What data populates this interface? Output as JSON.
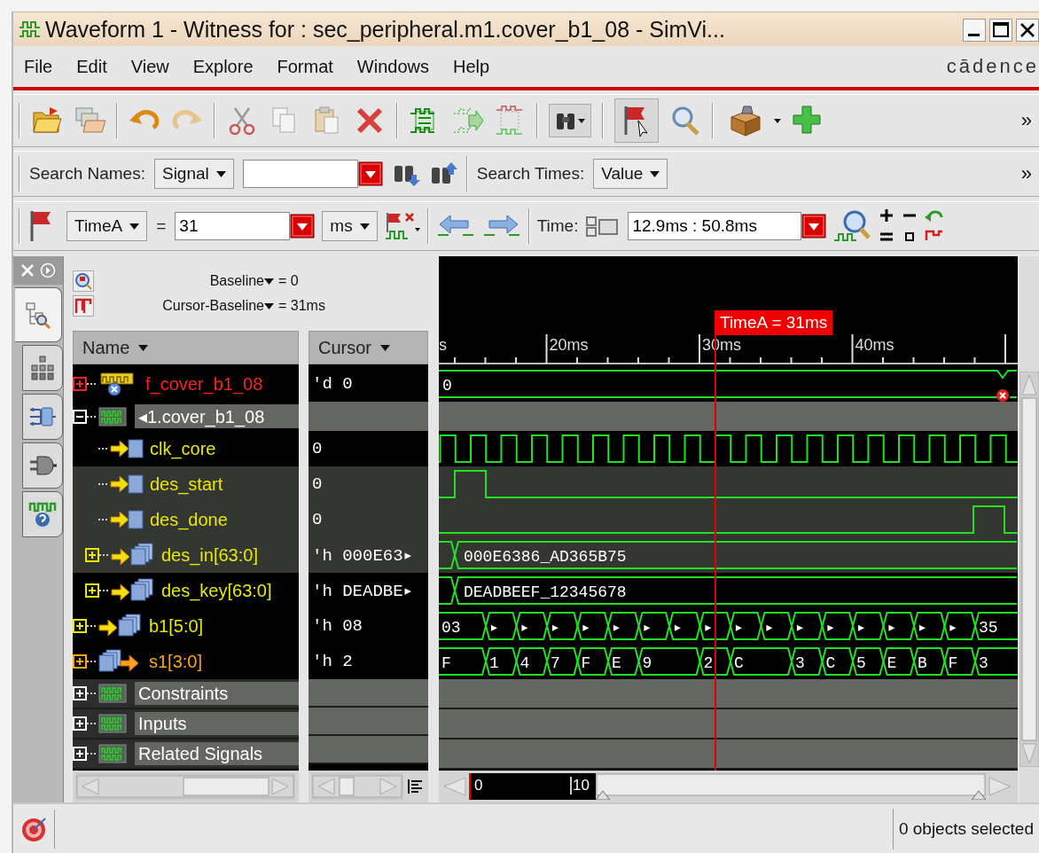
{
  "window": {
    "title": "Waveform 1 - Witness for : sec_peripheral.m1.cover_b1_08 - SimVi..."
  },
  "menu": [
    "File",
    "Edit",
    "View",
    "Explore",
    "Format",
    "Windows",
    "Help"
  ],
  "logo": "cādence",
  "main_toolbar": {
    "overflow": "»"
  },
  "search_bar": {
    "names_label": "Search Names:",
    "names_scope": "Signal",
    "times_label": "Search Times:",
    "times_scope": "Value",
    "overflow": "»"
  },
  "cursor_bar": {
    "cursor": "TimeA",
    "equals": "=",
    "value": "31",
    "unit": "ms",
    "time_label": "Time:",
    "time_range": "12.9ms : 50.8ms"
  },
  "side_tabs": [
    {
      "kind": "browser",
      "selected": true
    },
    {
      "kind": "hierarchy",
      "selected": false
    },
    {
      "kind": "schematic",
      "selected": false
    },
    {
      "kind": "plug",
      "selected": false
    },
    {
      "kind": "waves",
      "selected": false
    }
  ],
  "baseline": {
    "label": "Baseline",
    "value": "= 0",
    "offset_label": "Cursor-Baseline",
    "offset_value": "= 31ms"
  },
  "columns": [
    "Name",
    "Cursor"
  ],
  "timeline": {
    "ticks": [
      "s",
      "20ms",
      "30ms",
      "40ms"
    ],
    "cursor_label": "TimeA = 31ms"
  },
  "signals": [
    {
      "kind": "assertion",
      "name": "f_cover_b1_08",
      "color": "#ff2020",
      "expanded": false,
      "cursor": "'d 0",
      "shaded": false,
      "wave": {
        "kind": "bus",
        "values": [
          "0"
        ],
        "changes": false,
        "error": true
      }
    },
    {
      "kind": "group",
      "name": "◂1.cover_b1_08",
      "color": "#ffffff",
      "expanded": true,
      "wave": {
        "kind": "group"
      },
      "children": [
        {
          "kind": "signal",
          "name": "clk_core",
          "color": "#e8e800",
          "cursor": "0",
          "shaded": false,
          "wave": {
            "kind": "clock"
          }
        },
        {
          "kind": "signal",
          "name": "des_start",
          "color": "#e8e800",
          "cursor": "0",
          "shaded": true,
          "wave": {
            "kind": "pulse",
            "late": false
          }
        },
        {
          "kind": "signal",
          "name": "des_done",
          "color": "#e8e800",
          "cursor": "0",
          "shaded": true,
          "wave": {
            "kind": "pulse",
            "late": true
          }
        },
        {
          "kind": "bus",
          "name": "des_in[63:0]",
          "color": "#e8e800",
          "expanded": false,
          "cursor": "'h 000E63▸",
          "shaded": true,
          "wave": {
            "kind": "bus",
            "values": [
              "000E6386_AD365B75"
            ],
            "changes": true,
            "error": false
          }
        },
        {
          "kind": "bus",
          "name": "des_key[63:0]",
          "color": "#e8e800",
          "expanded": false,
          "cursor": "'h DEADBE▸",
          "shaded": false,
          "wave": {
            "kind": "bus",
            "values": [
              "DEADBEEF_12345678"
            ],
            "changes": true,
            "error": false
          }
        }
      ]
    },
    {
      "kind": "bus",
      "name": "b1[5:0]",
      "color": "#e8e800",
      "expanded": false,
      "cursor": "'h 08",
      "shaded": false,
      "wave": {
        "kind": "segments",
        "segments": [
          {
            "label": "03",
            "wide": true
          },
          {
            "label": "▸",
            "wide": false
          },
          {
            "label": "▸",
            "wide": false
          },
          {
            "label": "▸",
            "wide": false
          },
          {
            "label": "▸",
            "wide": false
          },
          {
            "label": "▸",
            "wide": false
          },
          {
            "label": "▸",
            "wide": false
          },
          {
            "label": "▸",
            "wide": false
          },
          {
            "label": "▸",
            "wide": false
          },
          {
            "label": "▸",
            "wide": false
          },
          {
            "label": "▸",
            "wide": false
          },
          {
            "label": "▸",
            "wide": false
          },
          {
            "label": "▸",
            "wide": false
          },
          {
            "label": "▸",
            "wide": false
          },
          {
            "label": "▸",
            "wide": false
          },
          {
            "label": "▸",
            "wide": false
          },
          {
            "label": "▸",
            "wide": false
          },
          {
            "label": "35",
            "wide": true
          }
        ]
      }
    },
    {
      "kind": "output",
      "name": "s1[3:0]",
      "color": "#ffa500",
      "expanded": false,
      "cursor": "'h 2",
      "shaded": false,
      "wave": {
        "kind": "segments",
        "segments": [
          {
            "label": "F",
            "wide": true
          },
          {
            "label": "1",
            "wide": false
          },
          {
            "label": "4",
            "wide": false
          },
          {
            "label": "7",
            "wide": false
          },
          {
            "label": "F",
            "wide": false
          },
          {
            "label": "E",
            "wide": false
          },
          {
            "label": "9",
            "wide": true
          },
          {
            "label": "2",
            "wide": false
          },
          {
            "label": "C",
            "wide": true
          },
          {
            "label": "3",
            "wide": false
          },
          {
            "label": "C",
            "wide": false
          },
          {
            "label": "5",
            "wide": false
          },
          {
            "label": "E",
            "wide": false
          },
          {
            "label": "B",
            "wide": false
          },
          {
            "label": "F",
            "wide": false
          },
          {
            "label": "3",
            "wide": true
          }
        ]
      }
    },
    {
      "kind": "folder",
      "name": "Constraints",
      "color": "#ffffff",
      "expanded": false,
      "wave": {
        "kind": "group"
      }
    },
    {
      "kind": "folder",
      "name": "Inputs",
      "color": "#ffffff",
      "expanded": false,
      "wave": {
        "kind": "group"
      }
    },
    {
      "kind": "folder",
      "name": "Related Signals",
      "color": "#ffffff",
      "expanded": false,
      "wave": {
        "kind": "group"
      }
    }
  ],
  "overview": {
    "ticks": [
      "0",
      "10"
    ]
  },
  "status_bar": {
    "text": "0 objects selected"
  }
}
